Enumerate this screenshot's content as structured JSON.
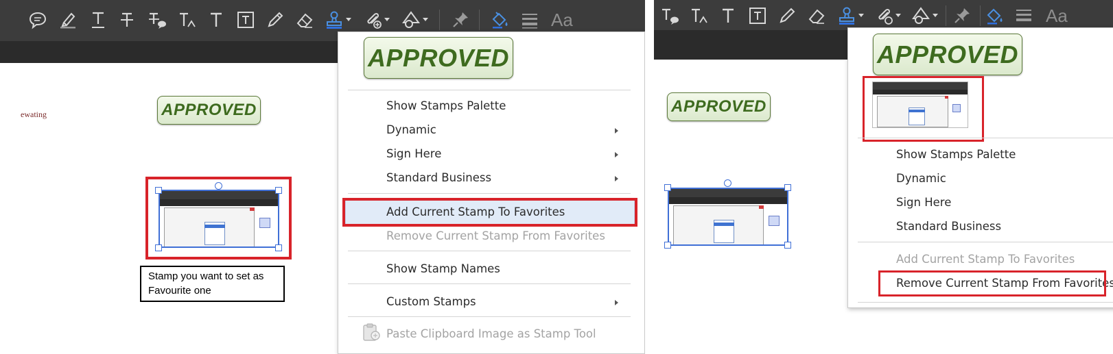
{
  "colors": {
    "toolbar_bg": "#3c3c3c",
    "subbar_bg": "#2b2b2b",
    "accent_blue": "#3f6fd6",
    "stamp_green": "#3e6b1f",
    "callout_red": "#d8232a",
    "menu_highlight": "#e1ebf8",
    "menu_disabled": "#a3a3a3"
  },
  "toolbar": {
    "icons": [
      "sticky-note-icon",
      "highlighter-icon",
      "underline-text-icon",
      "strikethrough-text-icon",
      "replace-text-icon",
      "insert-text-icon",
      "add-text-icon",
      "text-box-icon",
      "pencil-icon",
      "eraser-icon",
      "stamp-icon",
      "attach-file-icon",
      "shapes-icon",
      "pin-icon",
      "fill-color-icon",
      "line-weight-icon"
    ],
    "font_label": "Aa"
  },
  "left": {
    "faint_text": "ewating",
    "stamp_text": "APPROVED",
    "note_text": "Stamp you want to set as Favourite one"
  },
  "left_menu": {
    "preview_stamp_text": "APPROVED",
    "items": [
      {
        "label": "Show Stamps Palette",
        "state": "enabled"
      },
      {
        "label": "Dynamic",
        "state": "submenu"
      },
      {
        "label": "Sign Here",
        "state": "submenu"
      },
      {
        "label": "Standard Business",
        "state": "submenu"
      },
      {
        "label": "Add Current Stamp To Favorites",
        "state": "highlighted"
      },
      {
        "label": "Remove Current Stamp From Favorites",
        "state": "disabled"
      },
      {
        "label": "Show Stamp Names",
        "state": "enabled"
      },
      {
        "label": "Custom Stamps",
        "state": "submenu"
      },
      {
        "label": "Paste Clipboard Image as Stamp Tool",
        "state": "disabled"
      }
    ]
  },
  "right": {
    "stamp_text": "APPROVED"
  },
  "right_menu": {
    "preview_stamp_text": "APPROVED",
    "items": [
      {
        "label": "Show Stamps Palette",
        "state": "enabled"
      },
      {
        "label": "Dynamic",
        "state": "enabled"
      },
      {
        "label": "Sign Here",
        "state": "enabled"
      },
      {
        "label": "Standard Business",
        "state": "enabled"
      },
      {
        "label": "Add Current Stamp To Favorites",
        "state": "disabled"
      },
      {
        "label": "Remove Current Stamp From Favorites",
        "state": "enabled"
      }
    ]
  }
}
